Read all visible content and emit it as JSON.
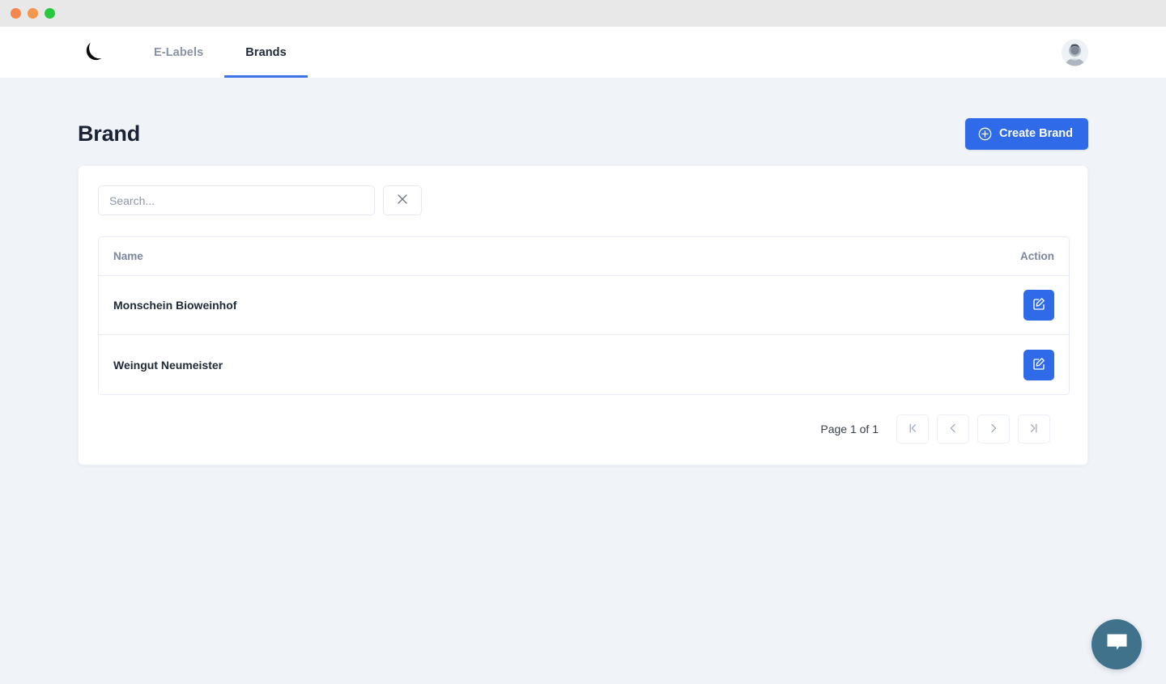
{
  "window": {
    "dots": [
      "close",
      "minimize",
      "maximize"
    ]
  },
  "nav": {
    "logo_name": "crescent-moon-logo",
    "tabs": [
      {
        "label": "E-Labels",
        "active": false
      },
      {
        "label": "Brands",
        "active": true
      }
    ],
    "avatar_alt": "User avatar"
  },
  "page": {
    "title": "Brand",
    "create_button": "Create Brand"
  },
  "search": {
    "value": "",
    "placeholder": "Search..."
  },
  "table": {
    "columns": [
      "Name",
      "Action"
    ],
    "rows": [
      {
        "name": "Monschein Bioweinhof"
      },
      {
        "name": "Weingut Neumeister"
      }
    ]
  },
  "pagination": {
    "label": "Page 1 of 1",
    "first": "|<",
    "prev": "<",
    "next": ">",
    "last": ">|"
  },
  "chat": {
    "name": "chat-widget"
  },
  "colors": {
    "accent": "#2f6be8",
    "tab_underline": "#3b74e8",
    "page_bg": "#f0f3f8",
    "chat_bg": "#40728b",
    "title": "#1a2235"
  }
}
